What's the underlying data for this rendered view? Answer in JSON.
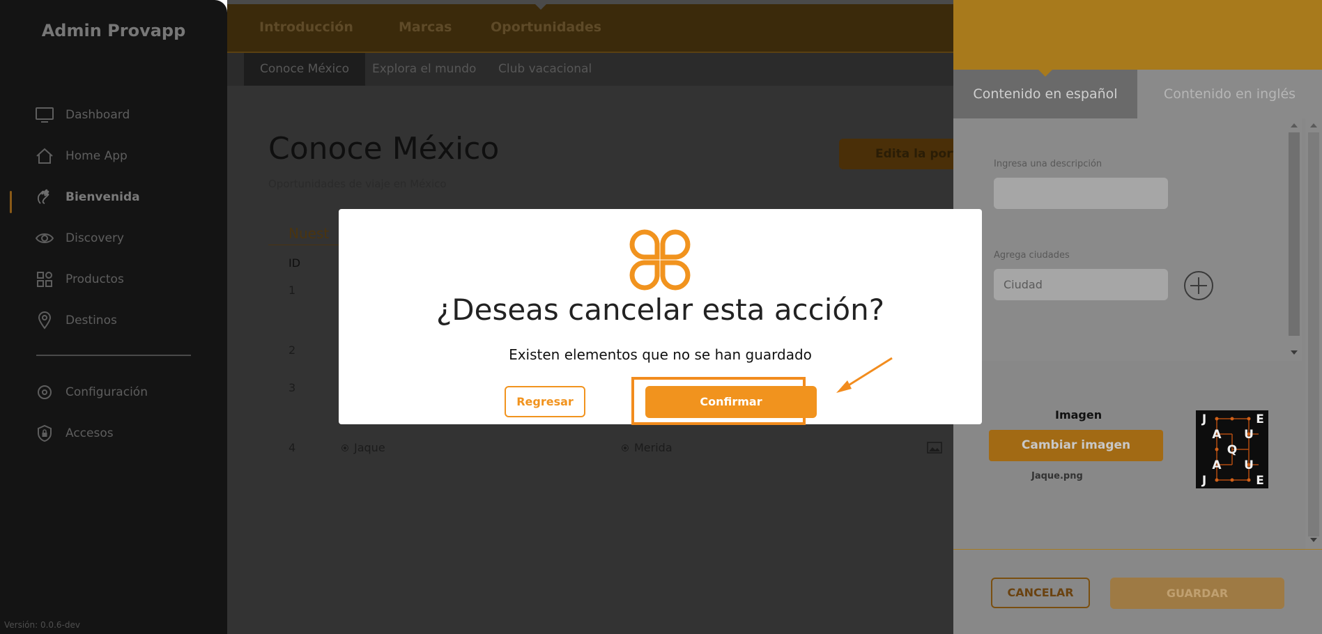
{
  "app": {
    "brand": "Admin Provapp",
    "version": "Versión: 0.0.6-dev"
  },
  "sidebar": {
    "items": [
      {
        "label": "Dashboard",
        "icon": "monitor-icon"
      },
      {
        "label": "Home App",
        "icon": "home-icon"
      },
      {
        "label": "Bienvenida",
        "icon": "waving-hand-icon",
        "active": true
      },
      {
        "label": "Discovery",
        "icon": "eye-icon"
      },
      {
        "label": "Productos",
        "icon": "grid-icon"
      },
      {
        "label": "Destinos",
        "icon": "location-pin-icon"
      },
      {
        "label": "Configuración",
        "icon": "gear-icon"
      },
      {
        "label": "Accesos",
        "icon": "shield-lock-icon"
      }
    ]
  },
  "topnav": {
    "tabs": [
      "Introducción",
      "Marcas",
      "Oportunidades"
    ],
    "active": "Oportunidades"
  },
  "subnav": {
    "tabs": [
      "Conoce México",
      "Explora el mundo",
      "Club vacacional"
    ],
    "active": "Conoce México"
  },
  "main": {
    "title": "Conoce México",
    "subtitle": "Oportunidades de viaje en México",
    "edit_button": "Edita la port",
    "section_label": "Nuest",
    "table": {
      "header_id": "ID",
      "row_ids": [
        "1",
        "2",
        "3",
        "4"
      ],
      "row4": {
        "name": "Jaque",
        "city": "Merida"
      }
    }
  },
  "panel": {
    "tabs": {
      "es": "Contenido en español",
      "en": "Contenido en inglés"
    },
    "description_label": "Ingresa una descripción",
    "description_value": "",
    "cities_label": "Agrega ciudades",
    "city_placeholder": "Ciudad",
    "image_label": "Imagen",
    "change_image": "Cambiar imagen",
    "filename": "Jaque.png",
    "logo_letters": [
      [
        "J",
        "",
        "",
        "E"
      ],
      [
        "A",
        "U",
        "",
        ""
      ],
      [
        "",
        "Q",
        "",
        ""
      ],
      [
        "A",
        "U",
        "",
        ""
      ],
      [
        "J",
        "",
        "",
        "E"
      ]
    ],
    "cancel": "CANCELAR",
    "save": "GUARDAR"
  },
  "modal": {
    "title": "¿Deseas cancelar esta acción?",
    "message": "Existen elementos que no se han guardado",
    "back": "Regresar",
    "confirm": "Confirmar"
  },
  "colors": {
    "accent": "#f1931e",
    "panel_header": "#a87a1c",
    "sidebar_bg": "#141414"
  }
}
